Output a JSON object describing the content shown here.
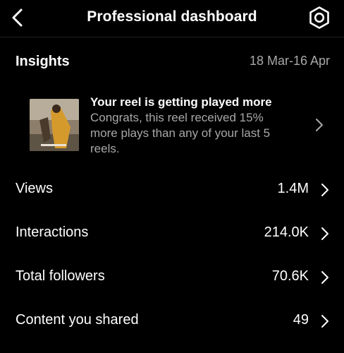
{
  "header": {
    "title": "Professional dashboard",
    "back_icon": "chevron-left-icon",
    "settings_icon": "gear-icon"
  },
  "insights": {
    "title": "Insights",
    "date_range": "18 Mar-16 Apr"
  },
  "reel_card": {
    "headline": "Your reel is getting played more",
    "body_line1": "Congrats, this reel received 15%",
    "body_line2": "more plays than any of your last 5",
    "body_line3": "reels."
  },
  "metrics": [
    {
      "label": "Views",
      "value": "1.4M"
    },
    {
      "label": "Interactions",
      "value": "214.0K"
    },
    {
      "label": "Total followers",
      "value": "70.6K"
    },
    {
      "label": "Content you shared",
      "value": "49"
    }
  ],
  "colors": {
    "background": "#000000",
    "text_primary": "#ffffff",
    "text_secondary": "#a8a8a8"
  }
}
